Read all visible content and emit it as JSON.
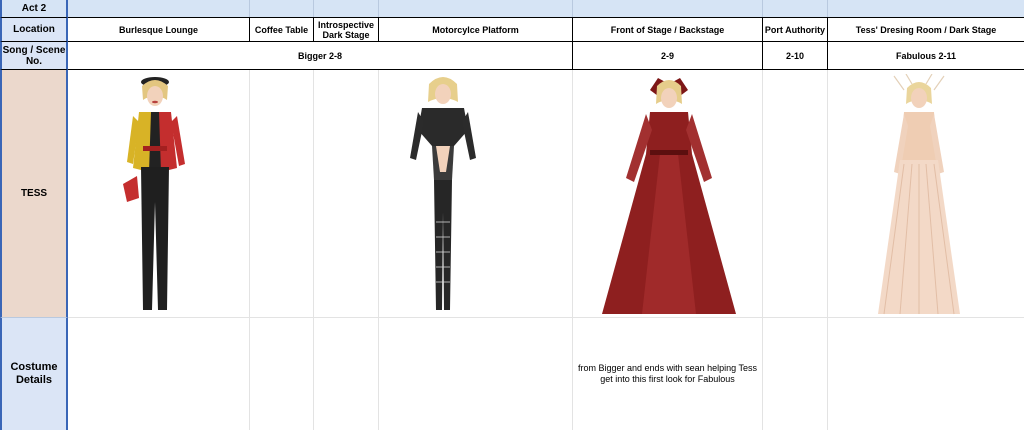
{
  "act": "Act 2",
  "labels": {
    "location": "Location",
    "song_scene": "Song / Scene No.",
    "character": "TESS",
    "costume_details": "Costume Details"
  },
  "locations": [
    "Burlesque Lounge",
    "Coffee Table",
    "Introspective Dark Stage",
    "Motorcylce Platform",
    "Front of Stage / Backstage",
    "Port Authority",
    "Tess' Dresing Room / Dark Stage"
  ],
  "scenes": {
    "bigger": "Bigger 2-8",
    "s29": "2-9",
    "s210": "2-10",
    "fabulous": "Fabulous 2-11"
  },
  "costume_note": "from Bigger and ends with sean helping Tess get into this first look for Fabulous",
  "colors": {
    "header_blue": "#d6e4f5",
    "label_pink": "#ebd8cc",
    "label_blue": "#dbe5f6",
    "border_blue": "#3a66b7",
    "gown_red": "#8e1f1f",
    "nude_gown": "#f0d2bd"
  }
}
